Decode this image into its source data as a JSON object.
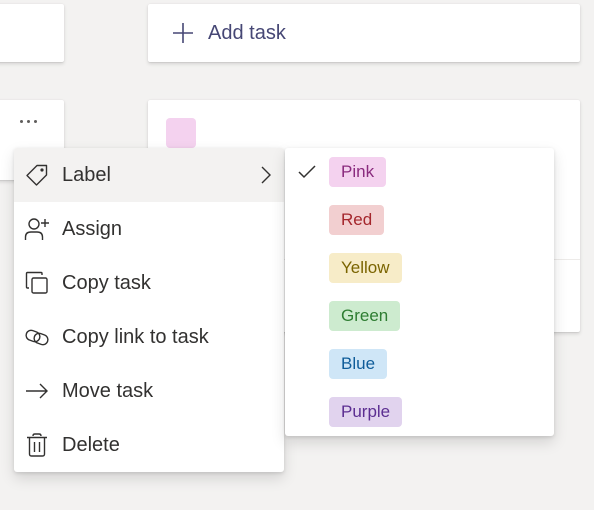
{
  "add_task": {
    "label": "Add task",
    "color": "#464775"
  },
  "task_card": {
    "label_swatch_color": "#f4d2ef"
  },
  "context_menu": {
    "items": [
      {
        "label": "Label",
        "icon": "tag-icon",
        "has_submenu": true,
        "active": true
      },
      {
        "label": "Assign",
        "icon": "add-person-icon"
      },
      {
        "label": "Copy task",
        "icon": "copy-icon"
      },
      {
        "label": "Copy link to task",
        "icon": "link-icon"
      },
      {
        "label": "Move task",
        "icon": "arrow-right-icon"
      },
      {
        "label": "Delete",
        "icon": "trash-icon"
      }
    ]
  },
  "label_submenu": {
    "items": [
      {
        "label": "Pink",
        "checked": true,
        "bg": "#f4d2ef",
        "fg": "#8a2b7e"
      },
      {
        "label": "Red",
        "checked": false,
        "bg": "#f2cfd0",
        "fg": "#a4262c"
      },
      {
        "label": "Yellow",
        "checked": false,
        "bg": "#f7ecc8",
        "fg": "#7a6400"
      },
      {
        "label": "Green",
        "checked": false,
        "bg": "#cdebcf",
        "fg": "#2e7d32"
      },
      {
        "label": "Blue",
        "checked": false,
        "bg": "#cfe6f7",
        "fg": "#0f5c99"
      },
      {
        "label": "Purple",
        "checked": false,
        "bg": "#e1d3ee",
        "fg": "#5c2e91"
      }
    ]
  }
}
